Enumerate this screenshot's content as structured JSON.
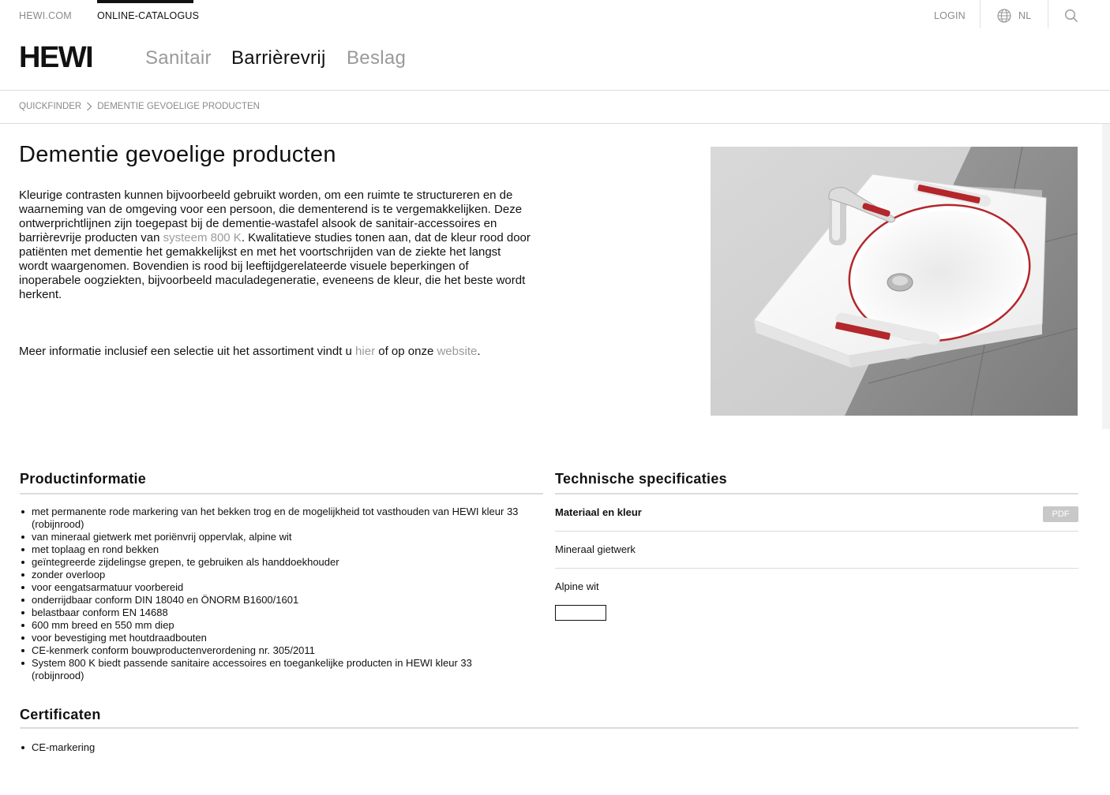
{
  "topbar": {
    "hewi_com": "HEWI.COM",
    "online_catalogus": "ONLINE-CATALOGUS",
    "login": "LOGIN",
    "language": "NL"
  },
  "logo": "HEWI",
  "mainnav": {
    "items": [
      {
        "label": "Sanitair"
      },
      {
        "label": "Barrièrevrij"
      },
      {
        "label": "Beslag"
      }
    ]
  },
  "breadcrumb": {
    "items": [
      "QUICKFINDER",
      "DEMENTIE GEVOELIGE PRODUCTEN"
    ]
  },
  "page": {
    "title": "Dementie gevoelige producten",
    "intro_part1": "Kleurige contrasten kunnen bijvoorbeeld gebruikt worden, om een ruimte te structureren en de waarneming van de omgeving voor een persoon, die dementerend is te vergemakkelijken. Deze ontwerprichtlijnen zijn toegepast bij de dementie-wastafel alsook de sanitair-accessoires en barrièrevrije producten van ",
    "intro_link": "systeem 800 K",
    "intro_part2": ". Kwalitatieve studies tonen aan, dat de kleur rood door patiënten met dementie het gemakkelijkst en met het voortschrijden van de ziekte het langst wordt waargenomen. Bovendien is rood bij leeftijdgerelateerde visuele beperkingen of inoperabele oogziekten, bijvoorbeeld maculadegeneratie, eveneens de kleur, die het beste wordt herkent.",
    "more_part1": "Meer informatie inclusief een selectie uit het assortiment vindt u ",
    "more_link1": "hier",
    "more_part2": " of op onze ",
    "more_link2": "website",
    "more_part3": "."
  },
  "productinfo": {
    "title": "Productinformatie",
    "items": [
      "met permanente rode markering van het bekken trog en de mogelijkheid tot vasthouden van HEWI kleur 33 (robijnrood)",
      "van mineraal gietwerk met poriënvrij oppervlak, alpine wit",
      "met toplaag en rond bekken",
      "geïntegreerde zijdelingse grepen, te gebruiken als handdoekhouder",
      "zonder overloop",
      "voor eengatsarmatuur voorbereid",
      "onderrijdbaar conform DIN 18040 en ÖNORM B1600/1601",
      "belastbaar conform EN 14688",
      "600 mm breed en 550 mm diep",
      "voor bevestiging met houtdraadbouten",
      "CE-kenmerk conform bouwproductenverordening nr. 305/2011",
      "System 800 K biedt passende sanitaire accessoires en toegankelijke producten in HEWI kleur 33 (robijnrood)"
    ]
  },
  "specs": {
    "title": "Technische specificaties",
    "material_label": "Materiaal en kleur",
    "pdf_label": "PDF",
    "material": "Mineraal gietwerk",
    "color": "Alpine wit",
    "swatch_color": "#ffffff"
  },
  "certificaten": {
    "title": "Certificaten",
    "items": [
      "CE-markering"
    ]
  },
  "colors": {
    "text": "#111111",
    "muted": "#8a8a8a",
    "link": "#9a9a9a",
    "accent_red": "#b3262b"
  }
}
